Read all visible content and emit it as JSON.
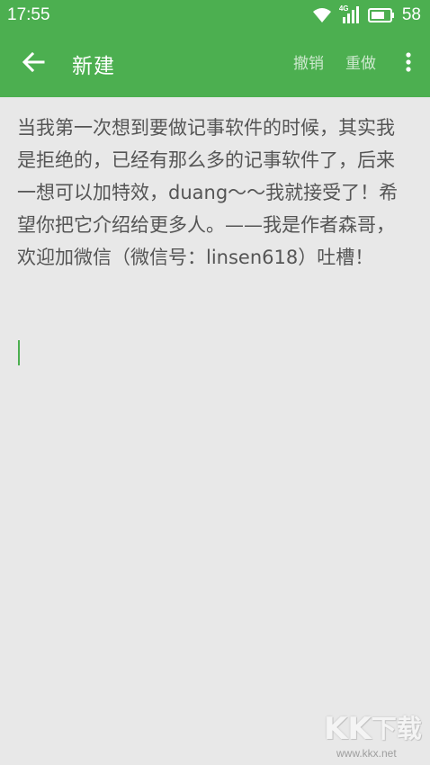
{
  "status_bar": {
    "time": "17:55",
    "network_label": "4G",
    "battery": "58",
    "icons": [
      "wifi-icon",
      "signal-icon",
      "battery-icon"
    ]
  },
  "app_bar": {
    "title": "新建",
    "undo_label": "撤销",
    "redo_label": "重做",
    "icons": [
      "back-arrow-icon",
      "more-vert-icon"
    ]
  },
  "editor": {
    "content": "当我第一次想到要做记事软件的时候，其实我是拒绝的，已经有那么多的记事软件了，后来一想可以加特效，duang〜〜我就接受了！希望你把它介绍给更多人。——我是作者森哥，欢迎加微信（微信号：linsen618）吐槽！"
  },
  "watermark": {
    "logo_letters": [
      "K",
      "K",
      "下",
      "载"
    ],
    "url": "www.kkx.net"
  },
  "colors": {
    "accent": "#4caf50",
    "background": "#e8e8e8",
    "text": "#555555"
  }
}
